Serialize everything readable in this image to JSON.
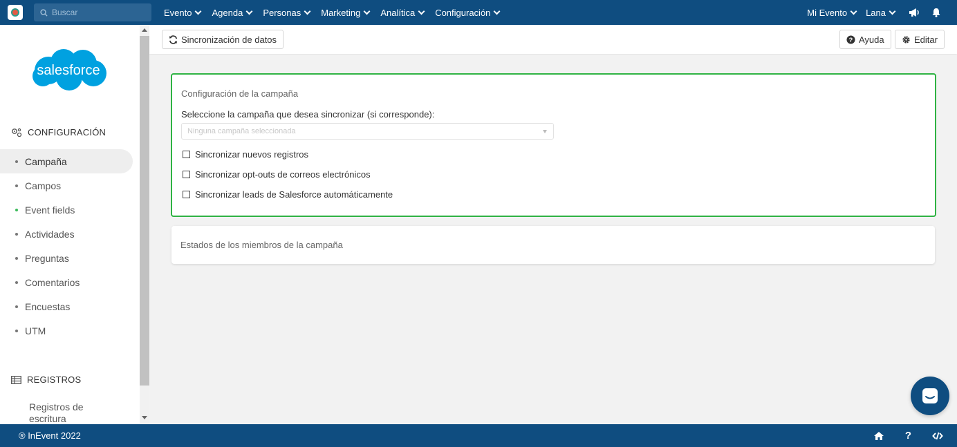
{
  "topbar": {
    "search_placeholder": "Buscar",
    "nav": [
      "Evento",
      "Agenda",
      "Personas",
      "Marketing",
      "Analítica",
      "Configuración"
    ],
    "right": {
      "event": "Mi Evento",
      "user": "Lana"
    },
    "icons": [
      "megaphone-icon",
      "bell-icon"
    ]
  },
  "sidebar": {
    "logo_text": "salesforce",
    "section_config": "CONFIGURACIÓN",
    "items": [
      {
        "label": "Campaña",
        "active": true
      },
      {
        "label": "Campos"
      },
      {
        "label": "Event fields",
        "dot_color": "#3dbb5c"
      },
      {
        "label": "Actividades"
      },
      {
        "label": "Preguntas"
      },
      {
        "label": "Comentarios"
      },
      {
        "label": "Encuestas"
      },
      {
        "label": "UTM"
      }
    ],
    "section_records": "REGISTROS",
    "records_item": {
      "line1": "Registros de",
      "line2": "escritura"
    }
  },
  "toolbar": {
    "sync_label": "Sincronización de datos",
    "help_label": "Ayuda",
    "edit_label": "Editar"
  },
  "campaign_card": {
    "title": "Configuración de la campaña",
    "select_label": "Seleccione la campaña que desea sincronizar (si corresponde):",
    "select_placeholder": "Ninguna campaña seleccionada",
    "checkboxes": [
      {
        "label": "Sincronizar nuevos registros",
        "checked": false
      },
      {
        "label": "Sincronizar opt-outs de correos electrónicos",
        "checked": false
      },
      {
        "label": "Sincronizar leads de Salesforce automáticamente",
        "checked": false
      }
    ]
  },
  "members_card": {
    "title": "Estados de los miembros de la campaña"
  },
  "footer": {
    "copyright": "® InEvent 2022",
    "icons": [
      "home-icon",
      "help-icon",
      "code-icon"
    ]
  },
  "colors": {
    "brand": "#0f4d80",
    "accent_green": "#2fb344",
    "salesforce_blue": "#00a1e0"
  }
}
